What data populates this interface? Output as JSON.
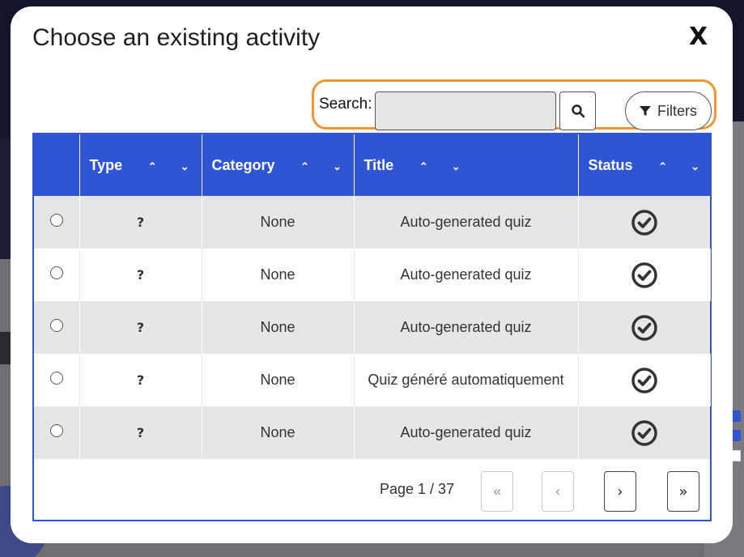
{
  "modal": {
    "title": "Choose an existing activity",
    "close_label": "X"
  },
  "search": {
    "label": "Search:",
    "value": "",
    "placeholder": "",
    "filters_label": "Filters"
  },
  "table": {
    "columns": [
      {
        "label": "",
        "sortable": false
      },
      {
        "label": "Type",
        "sortable": true
      },
      {
        "label": "Category",
        "sortable": true
      },
      {
        "label": "Title",
        "sortable": true
      },
      {
        "label": "Status",
        "sortable": true
      }
    ],
    "sort_up_glyph": "⌃",
    "sort_down_glyph": "⌄",
    "rows": [
      {
        "type": "?",
        "category": "None",
        "title": "Auto-generated quiz",
        "status": "check-circle-icon"
      },
      {
        "type": "?",
        "category": "None",
        "title": "Auto-generated quiz",
        "status": "check-circle-icon"
      },
      {
        "type": "?",
        "category": "None",
        "title": "Auto-generated quiz",
        "status": "check-circle-icon"
      },
      {
        "type": "?",
        "category": "None",
        "title": "Quiz généré automatiquement",
        "status": "check-circle-icon"
      },
      {
        "type": "?",
        "category": "None",
        "title": "Auto-generated quiz",
        "status": "check-circle-icon"
      }
    ]
  },
  "pagination": {
    "page_text": "Page 1 / 37",
    "first_label": "«",
    "prev_label": "‹",
    "next_label": "›",
    "last_label": "»"
  },
  "colors": {
    "header_bg": "#2f55d4",
    "highlight": "#ee9630",
    "row_alt": "#e6e6e6"
  }
}
